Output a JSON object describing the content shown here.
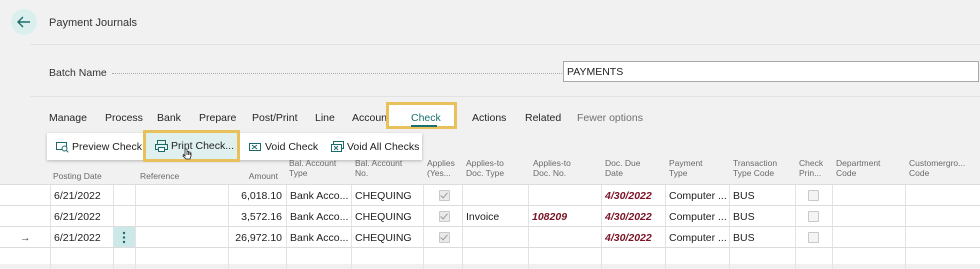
{
  "header": {
    "back_icon": "back-arrow-icon",
    "title": "Payment Journals"
  },
  "batch": {
    "label": "Batch Name",
    "value": "PAYMENTS"
  },
  "menu": {
    "items": [
      "Manage",
      "Process",
      "Bank",
      "Prepare",
      "Post/Print",
      "Line",
      "Accoun",
      "Check",
      "Actions",
      "Related",
      "Fewer options"
    ],
    "active": "Check"
  },
  "subactions": [
    {
      "label": "Preview Check",
      "icon": "preview-check-icon"
    },
    {
      "label": "Print Check...",
      "icon": "print-check-icon"
    },
    {
      "label": "Void Check",
      "icon": "void-check-icon"
    },
    {
      "label": "Void All Checks",
      "icon": "void-all-checks-icon"
    }
  ],
  "table": {
    "headers": {
      "posting_date": "Posting Date",
      "reference": "Reference",
      "amount": "Amount",
      "bal_account_type": "Bal. Account Type",
      "bal_account_no": "Bal. Account No.",
      "applies_yes": "Applies (Yes...",
      "applies_to_doc_type": "Applies-to Doc. Type",
      "applies_to_doc_no": "Applies-to Doc. No.",
      "doc_due_date": "Doc. Due Date",
      "payment_type": "Payment Type",
      "transaction_type_code": "Transaction Type Code",
      "check_printed": "Check Prin...",
      "department_code": "Department Code",
      "customergroup_code": "Customergro... Code"
    },
    "rows": [
      {
        "posting_date": "6/21/2022",
        "amount": "6,018.10",
        "bal_account_type": "Bank Acco...",
        "bal_account_no": "CHEQUING",
        "applies_to_doc_type": "",
        "applies_to_doc_no": "",
        "doc_due_date": "4/30/2022",
        "payment_type": "Computer ...",
        "transaction_type_code": "BUS"
      },
      {
        "posting_date": "6/21/2022",
        "amount": "3,572.16",
        "bal_account_type": "Bank Acco...",
        "bal_account_no": "CHEQUING",
        "applies_to_doc_type": "Invoice",
        "applies_to_doc_no": "108209",
        "doc_due_date": "4/30/2022",
        "payment_type": "Computer ...",
        "transaction_type_code": "BUS"
      },
      {
        "posting_date": "6/21/2022",
        "amount": "26,972.10",
        "bal_account_type": "Bank Acco...",
        "bal_account_no": "CHEQUING",
        "applies_to_doc_type": "",
        "applies_to_doc_no": "",
        "doc_due_date": "4/30/2022",
        "payment_type": "Computer ...",
        "transaction_type_code": "BUS"
      }
    ],
    "current_row_marker": "→"
  }
}
